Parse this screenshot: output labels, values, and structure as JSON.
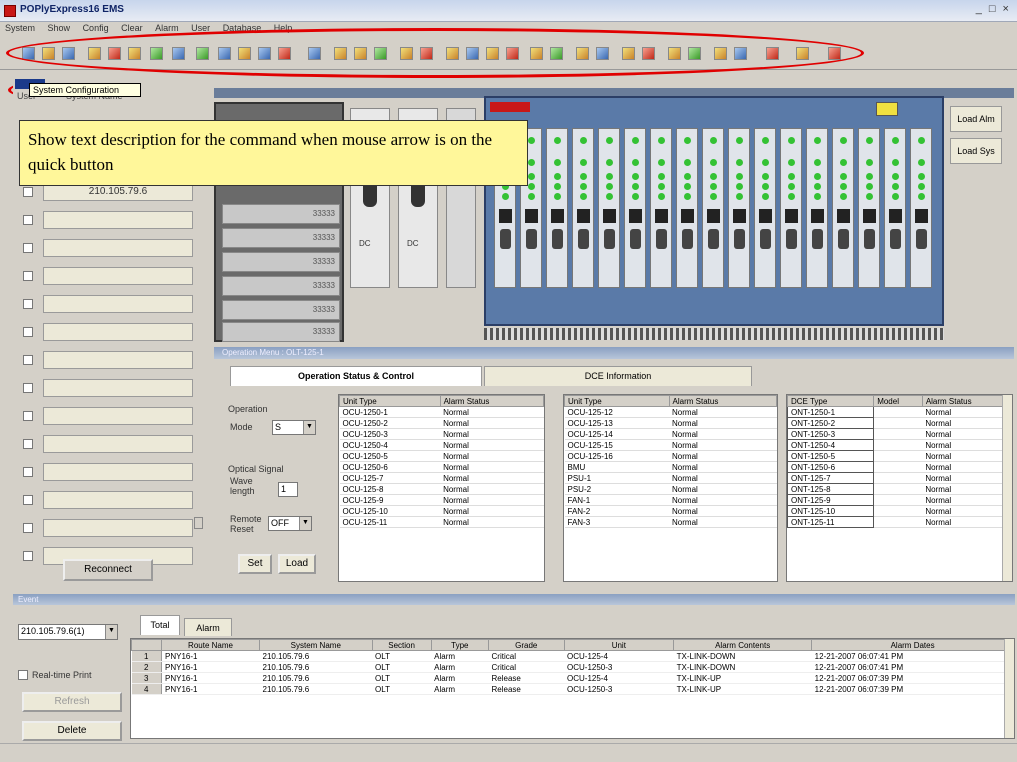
{
  "window": {
    "title": "POPlyExpress16 EMS",
    "controls": "_ □ ×"
  },
  "menu": [
    "System",
    "Show",
    "Config",
    "Clear",
    "Alarm",
    "User",
    "Database",
    "Help"
  ],
  "tooltip": "System Configuration",
  "callout": "Show text description for the command when mouse arrow is on the quick button",
  "left_panel": {
    "header_user": "User",
    "header_col": "System Name",
    "rows": [
      "210.105.79.6",
      "",
      "",
      "",
      "",
      "",
      "",
      "",
      "",
      "",
      "",
      "",
      "",
      "",
      "",
      ""
    ],
    "reconnect_label": "Reconnect"
  },
  "rack": {
    "psu_label": "DC",
    "load_alarm_label": "Load Alm",
    "load_sys_label": "Load Sys",
    "slot_text": "33333"
  },
  "operation": {
    "bar_title": "Operation Menu : OLT-125-1",
    "tabs": [
      "Operation Status & Control",
      "DCE Information"
    ],
    "group_operation": "Operation",
    "mode_label": "Mode",
    "mode_value": "S",
    "group_optical": "Optical Signal",
    "wave_label": "Wave length",
    "wave_value": "1",
    "remote_label": "Remote Reset",
    "remote_value": "OFF",
    "set_label": "Set",
    "load_label": "Load",
    "table1": {
      "headers": [
        "Unit Type",
        "Alarm Status"
      ],
      "rows": [
        [
          "OCU-1250-1",
          "Normal"
        ],
        [
          "OCU-1250-2",
          "Normal"
        ],
        [
          "OCU-1250-3",
          "Normal"
        ],
        [
          "OCU-1250-4",
          "Normal"
        ],
        [
          "OCU-1250-5",
          "Normal"
        ],
        [
          "OCU-1250-6",
          "Normal"
        ],
        [
          "OCU-125-7",
          "Normal"
        ],
        [
          "OCU-125-8",
          "Normal"
        ],
        [
          "OCU-125-9",
          "Normal"
        ],
        [
          "OCU-125-10",
          "Normal"
        ],
        [
          "OCU-125-11",
          "Normal"
        ]
      ]
    },
    "table2": {
      "headers": [
        "Unit Type",
        "Alarm Status"
      ],
      "rows": [
        [
          "OCU-125-12",
          "Normal"
        ],
        [
          "OCU-125-13",
          "Normal"
        ],
        [
          "OCU-125-14",
          "Normal"
        ],
        [
          "OCU-125-15",
          "Normal"
        ],
        [
          "OCU-125-16",
          "Normal"
        ],
        [
          "BMU",
          "Normal"
        ],
        [
          "PSU-1",
          "Normal"
        ],
        [
          "PSU-2",
          "Normal"
        ],
        [
          "FAN-1",
          "Normal"
        ],
        [
          "FAN-2",
          "Normal"
        ],
        [
          "FAN-3",
          "Normal"
        ]
      ]
    },
    "table3": {
      "headers": [
        "DCE Type",
        "Model",
        "Alarm Status"
      ],
      "rows": [
        [
          "ONT-1250-1",
          "",
          "Normal"
        ],
        [
          "ONT-1250-2",
          "",
          "Normal"
        ],
        [
          "ONT-1250-3",
          "",
          "Normal"
        ],
        [
          "ONT-1250-4",
          "",
          "Normal"
        ],
        [
          "ONT-1250-5",
          "",
          "Normal"
        ],
        [
          "ONT-1250-6",
          "",
          "Normal"
        ],
        [
          "ONT-125-7",
          "",
          "Normal"
        ],
        [
          "ONT-125-8",
          "",
          "Normal"
        ],
        [
          "ONT-125-9",
          "",
          "Normal"
        ],
        [
          "ONT-125-10",
          "",
          "Normal"
        ],
        [
          "ONT-125-11",
          "",
          "Normal"
        ]
      ]
    }
  },
  "events": {
    "bar_title": "Event",
    "system_select": "210.105.79.6(1)",
    "tabs": [
      "Total",
      "Alarm"
    ],
    "realtime_label": "Real-time Print",
    "refresh_label": "Refresh",
    "delete_label": "Delete",
    "headers": [
      "Route Name",
      "System Name",
      "Section",
      "Type",
      "Grade",
      "Unit",
      "Alarm Contents",
      "Alarm Dates"
    ],
    "rows": [
      [
        "1",
        "PNY16-1",
        "210.105.79.6",
        "OLT",
        "Alarm",
        "Critical",
        "OCU-125-4",
        "TX-LINK-DOWN",
        "12-21-2007 06:07:41 PM"
      ],
      [
        "2",
        "PNY16-1",
        "210.105.79.6",
        "OLT",
        "Alarm",
        "Critical",
        "OCU-1250-3",
        "TX-LINK-DOWN",
        "12-21-2007 06:07:41 PM"
      ],
      [
        "3",
        "PNY16-1",
        "210.105.79.6",
        "OLT",
        "Alarm",
        "Release",
        "OCU-125-4",
        "TX-LINK-UP",
        "12-21-2007 06:07:39 PM"
      ],
      [
        "4",
        "PNY16-1",
        "210.105.79.6",
        "OLT",
        "Alarm",
        "Release",
        "OCU-1250-3",
        "TX-LINK-UP",
        "12-21-2007 06:07:39 PM"
      ]
    ]
  },
  "colors": {
    "highlight": "#e00000",
    "callout_bg": "#fff79a",
    "led_green": "#34c234"
  }
}
